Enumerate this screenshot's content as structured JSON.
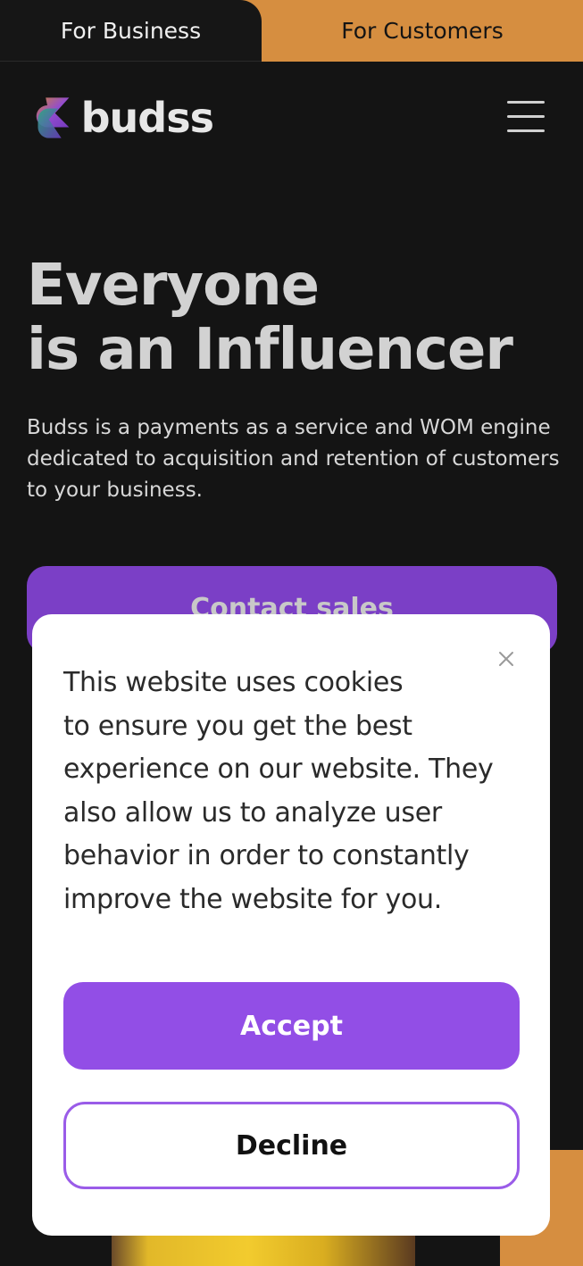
{
  "tabs": {
    "business": "For Business",
    "customers": "For Customers"
  },
  "header": {
    "logo_text": "budss",
    "menu_icon": "hamburger-menu-icon"
  },
  "hero": {
    "title_lines": [
      "Everyone",
      "is an Influencer"
    ],
    "description": "Budss is a payments as a service and WOM engine dedicated to acquisition and retention of customers to your business.",
    "contact_label": "Contact sales"
  },
  "cookie_modal": {
    "close_icon": "close-icon",
    "text_lines": [
      "This website uses cookies",
      "to ensure you get the best",
      "experience on our website. They",
      "also allow us to analyze user",
      "behavior in order to constantly",
      "improve the website for you."
    ],
    "accept_label": "Accept",
    "decline_label": "Decline"
  },
  "colors": {
    "background": "#141414",
    "accent_orange": "#d68e40",
    "accent_purple": "#924ee6",
    "modal_bg": "#ffffff"
  }
}
